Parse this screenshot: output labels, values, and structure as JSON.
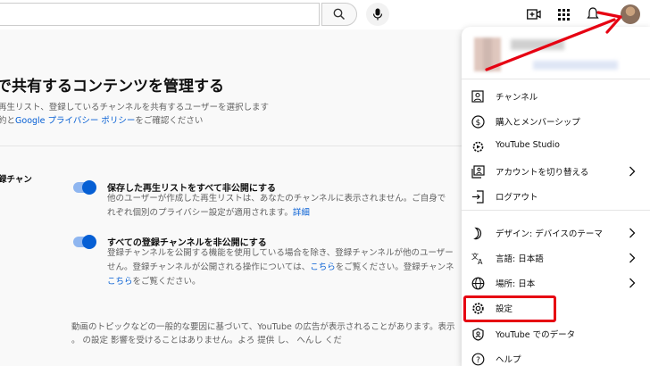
{
  "header": {
    "search_placeholder": "",
    "icons": [
      "search-icon",
      "mic-icon",
      "create-icon",
      "apps-icon",
      "notifications-icon",
      "avatar"
    ]
  },
  "privacy": {
    "title": "で共有するコンテンツを管理する",
    "desc_line1": "再生リスト、登録しているチャンネルを共有するユーザーを選択します",
    "desc_line2_prefix": "約と",
    "desc_line2_link": "Google プライバシー ポリシー",
    "desc_line2_suffix": "をご確認ください",
    "section_label": "録チャン",
    "option1": {
      "title": "保存した再生リストをすべて非公開にする",
      "desc_line1": "他のユーザーが作成した再生リストは、あなたのチャンネルに表示されません。ご自身で",
      "desc_line2": "れぞれ個別のプライバシー設定が適用されます。",
      "desc_link": "詳細"
    },
    "option2": {
      "title": "すべての登録チャンネルを非公開にする",
      "desc_line1": "登録チャンネルを公開する機能を使用している場合を除き、登録チャンネルが他のユーザー",
      "desc_line2_prefix": "せん。登録チャンネルが公開される操作については、",
      "desc_line2_link": "こちら",
      "desc_line2_suffix": "をご覧ください。登録チャンネ",
      "desc_line3_link": "こちら",
      "desc_line3_suffix": "をご覧ください。"
    },
    "bottom_line1": "動画のトピックなどの一般的な要因に基づいて、YouTube の広告が表示されることがあります。表示",
    "bottom_line2": "。   の設定  影響を受けることはありません。よろ  提供  し、      へんし  くだ"
  },
  "menu": {
    "items": [
      {
        "label": "チャンネル",
        "icon": "channel-icon",
        "chevron": false
      },
      {
        "label": "購入とメンバーシップ",
        "icon": "dollar-icon",
        "chevron": false
      },
      {
        "label": "YouTube Studio",
        "icon": "studio-gear-icon",
        "chevron": false
      },
      {
        "label": "アカウントを切り替える",
        "icon": "switch-account-icon",
        "chevron": true
      },
      {
        "label": "ログアウト",
        "icon": "logout-icon",
        "chevron": false
      },
      {
        "label": "デザイン: デバイスのテーマ",
        "icon": "moon-icon",
        "chevron": true
      },
      {
        "label": "言語: 日本語",
        "icon": "translate-icon",
        "chevron": true
      },
      {
        "label": "場所: 日本",
        "icon": "globe-icon",
        "chevron": true
      },
      {
        "label": "設定",
        "icon": "settings-gear-icon",
        "chevron": false
      },
      {
        "label": "YouTube でのデータ",
        "icon": "data-icon",
        "chevron": false
      },
      {
        "label": "ヘルプ",
        "icon": "help-icon",
        "chevron": false
      }
    ]
  },
  "colors": {
    "accent": "#065fd4",
    "annotation_red": "#e60012"
  }
}
